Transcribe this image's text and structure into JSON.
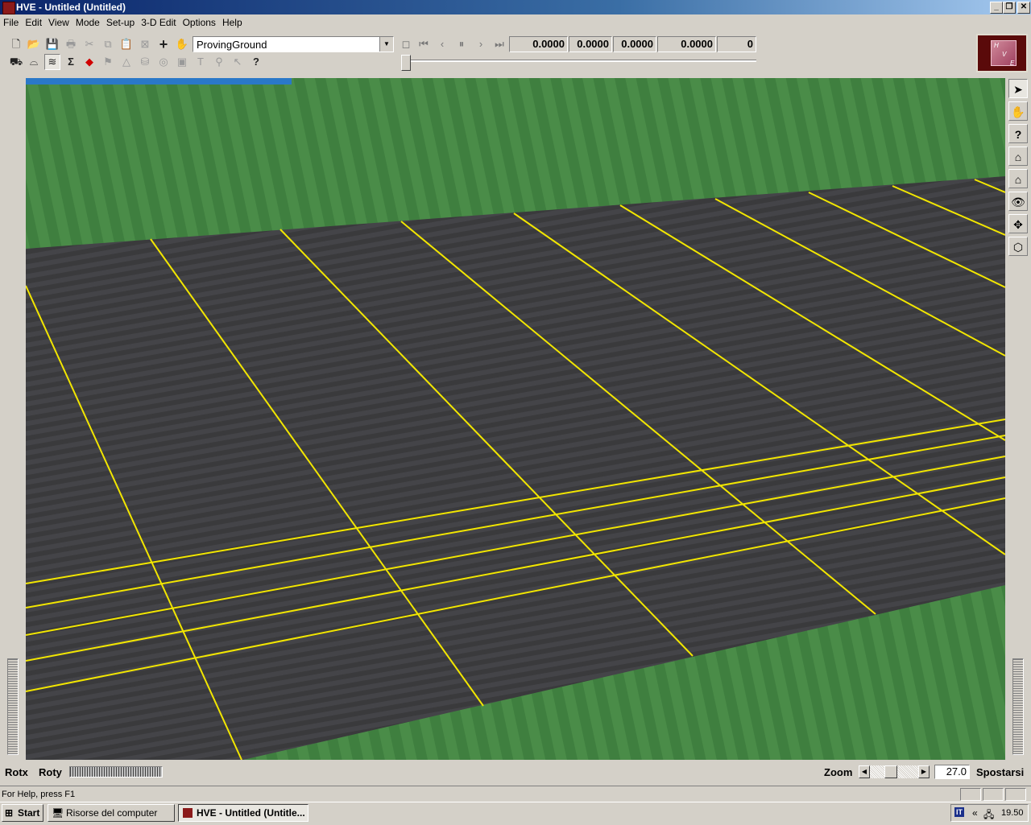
{
  "window": {
    "title": "HVE - Untitled (Untitled)"
  },
  "menu": [
    "File",
    "Edit",
    "View",
    "Mode",
    "Set-up",
    "3-D Edit",
    "Options",
    "Help"
  ],
  "toolbar": {
    "scene_selector": "ProvingGround",
    "readouts": [
      "0.0000",
      "0.0000",
      "0.0000",
      "0.0000",
      "0"
    ]
  },
  "logo": {
    "letters": [
      "H",
      "V",
      "E"
    ]
  },
  "controls": {
    "rotx_label": "Rotx",
    "roty_label": "Roty",
    "zoom_label": "Zoom",
    "zoom_value": "27.0",
    "move_label": "Spostarsi"
  },
  "status": {
    "text": "For Help, press F1"
  },
  "taskbar": {
    "start": "Start",
    "tasks": [
      "Risorse del computer",
      "HVE - Untitled (Untitle..."
    ],
    "tray_lang": "IT",
    "tray_chevron": "«",
    "clock": "19.50"
  },
  "colors": {
    "grass": "#3f7f3f",
    "asphalt": "#3a3a3c",
    "lane_line": "#f2e600",
    "titlebar": "#0a246a"
  }
}
